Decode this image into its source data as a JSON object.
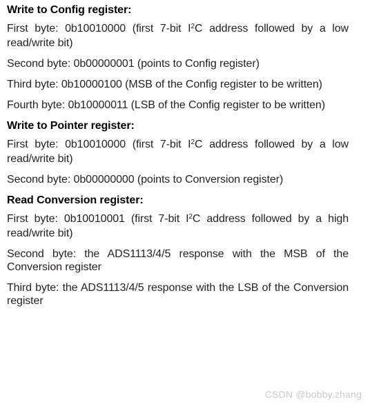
{
  "document": {
    "sections": [
      {
        "heading": "Write to Config register:",
        "paragraphs": [
          {
            "pre": "First byte: 0b10010000 (first 7-bit I",
            "sup": "2",
            "post": "C address followed by a low read/write bit)"
          },
          {
            "text": "Second byte: 0b00000001 (points to Config register)"
          },
          {
            "text": "Third byte: 0b10000100 (MSB of the Config register to be written)"
          },
          {
            "text": "Fourth byte: 0b10000011 (LSB of the Config register to be written)"
          }
        ]
      },
      {
        "heading": "Write to Pointer register:",
        "paragraphs": [
          {
            "pre": "First byte: 0b10010000 (first 7-bit I",
            "sup": "2",
            "post": "C address followed by a low read/write bit)"
          },
          {
            "text": "Second byte: 0b00000000 (points to Conversion register)"
          }
        ]
      },
      {
        "heading": "Read Conversion register:",
        "paragraphs": [
          {
            "pre": "First byte: 0b10010001 (first 7-bit I",
            "sup": "2",
            "post": "C address followed by a high read/write bit)"
          },
          {
            "text": "Second byte: the ADS1113/4/5 response with the MSB of the Conversion register"
          },
          {
            "text": "Third byte: the ADS1113/4/5 response with the LSB of the Conversion register"
          }
        ]
      }
    ],
    "watermark": "CSDN @bobby.zhang",
    "colors": {
      "text": "#231f20",
      "heading": "#000000",
      "watermark": "#c9c9c9",
      "background": "#ffffff"
    }
  }
}
